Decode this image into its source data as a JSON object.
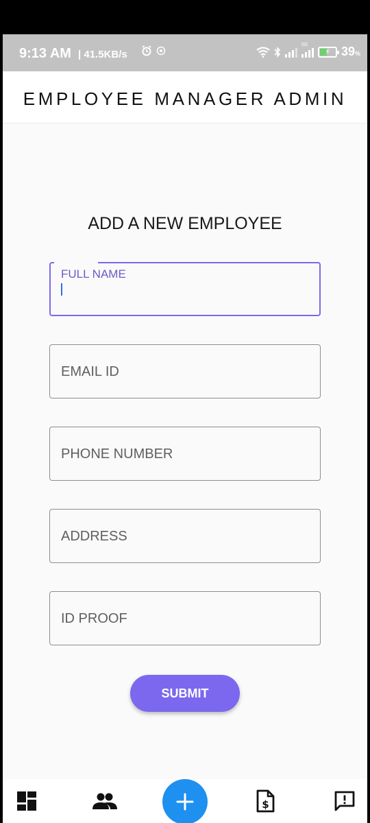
{
  "status_bar": {
    "time": "9:13 AM",
    "net_speed": "| 41.5KB/s",
    "battery_percent": "39",
    "battery_percent_unit": "%",
    "network_type": "5G",
    "icons": [
      "alarm-icon",
      "sync-icon",
      "wifi-icon",
      "bluetooth-icon",
      "signal-icon",
      "battery-charging-icon"
    ]
  },
  "app_bar": {
    "title": "EMPLOYEE MANAGER ADMIN"
  },
  "form": {
    "heading": "ADD A NEW EMPLOYEE",
    "fields": [
      {
        "label": "FULL NAME",
        "value": "",
        "focused": true
      },
      {
        "label": "EMAIL ID",
        "value": ""
      },
      {
        "label": "PHONE NUMBER",
        "value": ""
      },
      {
        "label": "ADDRESS",
        "value": ""
      },
      {
        "label": "ID PROOF",
        "value": ""
      }
    ],
    "submit_label": "SUBMIT"
  },
  "bottom_nav": {
    "items": [
      "dashboard-icon",
      "employees-icon",
      "add-icon",
      "invoice-icon",
      "feedback-icon"
    ]
  },
  "colors": {
    "accent": "#7b68ee",
    "fab": "#1e90f0",
    "status_bar": "#c2c2c2"
  }
}
